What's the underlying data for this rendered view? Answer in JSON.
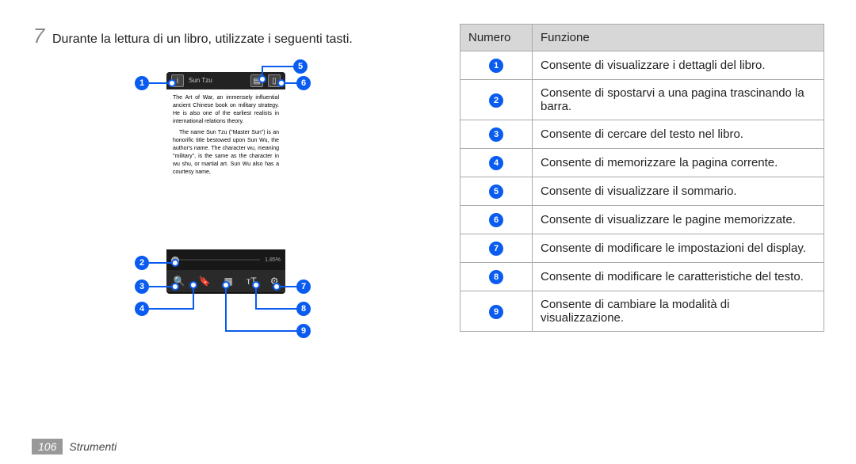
{
  "step": {
    "number": "7",
    "text": "Durante la lettura di un libro, utilizzate i seguenti tasti."
  },
  "phone": {
    "title": "Sun Tzu",
    "body_p1": "The Art of War, an immensely influential ancient Chinese book on military strategy. He is also one of the earliest realists in international relations theory.",
    "body_p2": "The name Sun Tzu (\"Master Sun\") is an honorific title bestowed upon Sun Wu, the author's name. The character wu, meaning \"military\", is the same as the character in wu shu, or martial art. Sun Wu also has a courtesy name,",
    "progress_percent": "1.85%"
  },
  "callouts": {
    "c1": "1",
    "c2": "2",
    "c3": "3",
    "c4": "4",
    "c5": "5",
    "c6": "6",
    "c7": "7",
    "c8": "8",
    "c9": "9"
  },
  "table": {
    "head_num": "Numero",
    "head_func": "Funzione",
    "rows": [
      {
        "n": "1",
        "f": "Consente di visualizzare i dettagli del libro."
      },
      {
        "n": "2",
        "f": "Consente di spostarvi a una pagina trascinando la barra."
      },
      {
        "n": "3",
        "f": "Consente di cercare del testo nel libro."
      },
      {
        "n": "4",
        "f": "Consente di memorizzare la pagina corrente."
      },
      {
        "n": "5",
        "f": "Consente di visualizzare il sommario."
      },
      {
        "n": "6",
        "f": "Consente di visualizzare le pagine memorizzate."
      },
      {
        "n": "7",
        "f": "Consente di modificare le impostazioni del display."
      },
      {
        "n": "8",
        "f": "Consente di modificare le caratteristiche del testo."
      },
      {
        "n": "9",
        "f": "Consente di cambiare la modalità di visualizzazione."
      }
    ]
  },
  "footer": {
    "page_number": "106",
    "section": "Strumenti"
  }
}
